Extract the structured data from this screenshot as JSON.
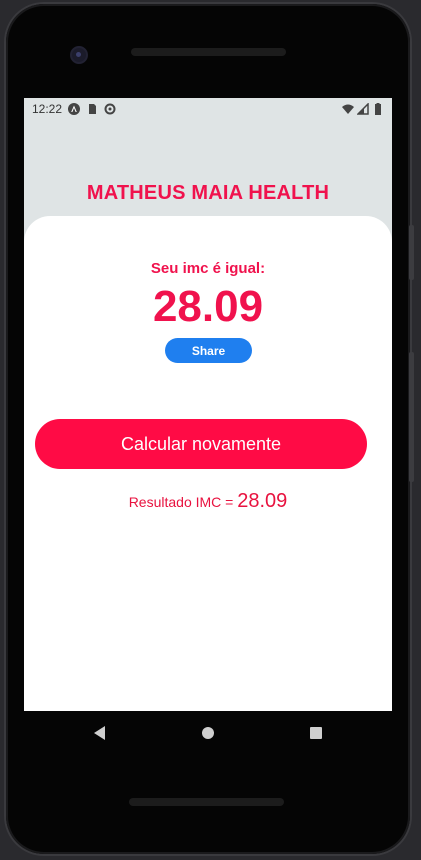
{
  "status_bar": {
    "time": "12:22",
    "left_icons": [
      "android-studio-icon",
      "sd-card-icon",
      "sync-icon"
    ],
    "right_icons": [
      "wifi-icon",
      "signal-icon",
      "battery-icon"
    ]
  },
  "app": {
    "title": "MATHEUS MAIA HEALTH",
    "result_label": "Seu imc é igual:",
    "result_value": "28.09",
    "share_label": "Share",
    "recalculate_label": "Calcular novamente",
    "result_prefix": "Resultado IMC = ",
    "result_suffix_value": "28.09"
  },
  "navigation": {
    "buttons": [
      "back-icon",
      "home-icon",
      "recents-icon"
    ]
  },
  "colors": {
    "accent": "#f0124d",
    "share_button": "#1f7fef",
    "primary_button": "#ff0b45"
  }
}
